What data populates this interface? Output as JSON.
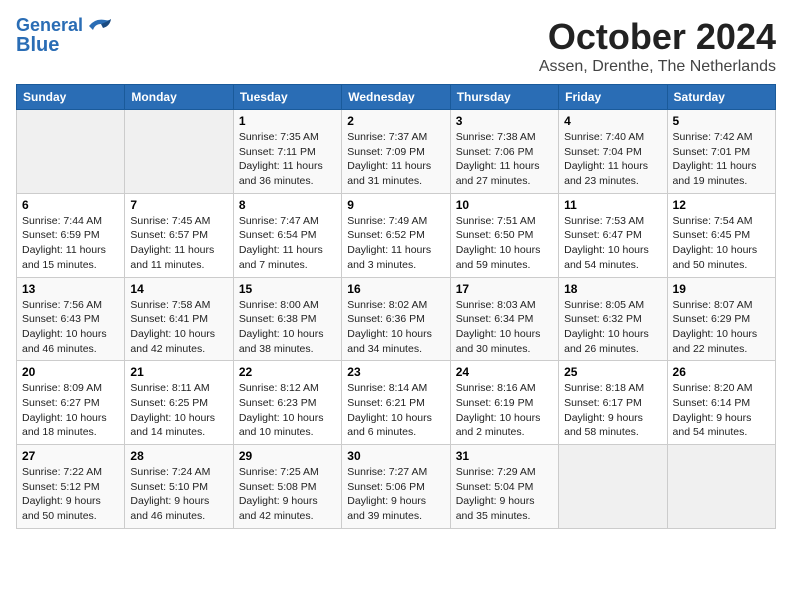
{
  "logo": {
    "line1": "General",
    "line2": "Blue"
  },
  "title": "October 2024",
  "location": "Assen, Drenthe, The Netherlands",
  "days_of_week": [
    "Sunday",
    "Monday",
    "Tuesday",
    "Wednesday",
    "Thursday",
    "Friday",
    "Saturday"
  ],
  "weeks": [
    [
      {
        "day": "",
        "sunrise": "",
        "sunset": "",
        "daylight": ""
      },
      {
        "day": "",
        "sunrise": "",
        "sunset": "",
        "daylight": ""
      },
      {
        "day": "1",
        "sunrise": "Sunrise: 7:35 AM",
        "sunset": "Sunset: 7:11 PM",
        "daylight": "Daylight: 11 hours and 36 minutes."
      },
      {
        "day": "2",
        "sunrise": "Sunrise: 7:37 AM",
        "sunset": "Sunset: 7:09 PM",
        "daylight": "Daylight: 11 hours and 31 minutes."
      },
      {
        "day": "3",
        "sunrise": "Sunrise: 7:38 AM",
        "sunset": "Sunset: 7:06 PM",
        "daylight": "Daylight: 11 hours and 27 minutes."
      },
      {
        "day": "4",
        "sunrise": "Sunrise: 7:40 AM",
        "sunset": "Sunset: 7:04 PM",
        "daylight": "Daylight: 11 hours and 23 minutes."
      },
      {
        "day": "5",
        "sunrise": "Sunrise: 7:42 AM",
        "sunset": "Sunset: 7:01 PM",
        "daylight": "Daylight: 11 hours and 19 minutes."
      }
    ],
    [
      {
        "day": "6",
        "sunrise": "Sunrise: 7:44 AM",
        "sunset": "Sunset: 6:59 PM",
        "daylight": "Daylight: 11 hours and 15 minutes."
      },
      {
        "day": "7",
        "sunrise": "Sunrise: 7:45 AM",
        "sunset": "Sunset: 6:57 PM",
        "daylight": "Daylight: 11 hours and 11 minutes."
      },
      {
        "day": "8",
        "sunrise": "Sunrise: 7:47 AM",
        "sunset": "Sunset: 6:54 PM",
        "daylight": "Daylight: 11 hours and 7 minutes."
      },
      {
        "day": "9",
        "sunrise": "Sunrise: 7:49 AM",
        "sunset": "Sunset: 6:52 PM",
        "daylight": "Daylight: 11 hours and 3 minutes."
      },
      {
        "day": "10",
        "sunrise": "Sunrise: 7:51 AM",
        "sunset": "Sunset: 6:50 PM",
        "daylight": "Daylight: 10 hours and 59 minutes."
      },
      {
        "day": "11",
        "sunrise": "Sunrise: 7:53 AM",
        "sunset": "Sunset: 6:47 PM",
        "daylight": "Daylight: 10 hours and 54 minutes."
      },
      {
        "day": "12",
        "sunrise": "Sunrise: 7:54 AM",
        "sunset": "Sunset: 6:45 PM",
        "daylight": "Daylight: 10 hours and 50 minutes."
      }
    ],
    [
      {
        "day": "13",
        "sunrise": "Sunrise: 7:56 AM",
        "sunset": "Sunset: 6:43 PM",
        "daylight": "Daylight: 10 hours and 46 minutes."
      },
      {
        "day": "14",
        "sunrise": "Sunrise: 7:58 AM",
        "sunset": "Sunset: 6:41 PM",
        "daylight": "Daylight: 10 hours and 42 minutes."
      },
      {
        "day": "15",
        "sunrise": "Sunrise: 8:00 AM",
        "sunset": "Sunset: 6:38 PM",
        "daylight": "Daylight: 10 hours and 38 minutes."
      },
      {
        "day": "16",
        "sunrise": "Sunrise: 8:02 AM",
        "sunset": "Sunset: 6:36 PM",
        "daylight": "Daylight: 10 hours and 34 minutes."
      },
      {
        "day": "17",
        "sunrise": "Sunrise: 8:03 AM",
        "sunset": "Sunset: 6:34 PM",
        "daylight": "Daylight: 10 hours and 30 minutes."
      },
      {
        "day": "18",
        "sunrise": "Sunrise: 8:05 AM",
        "sunset": "Sunset: 6:32 PM",
        "daylight": "Daylight: 10 hours and 26 minutes."
      },
      {
        "day": "19",
        "sunrise": "Sunrise: 8:07 AM",
        "sunset": "Sunset: 6:29 PM",
        "daylight": "Daylight: 10 hours and 22 minutes."
      }
    ],
    [
      {
        "day": "20",
        "sunrise": "Sunrise: 8:09 AM",
        "sunset": "Sunset: 6:27 PM",
        "daylight": "Daylight: 10 hours and 18 minutes."
      },
      {
        "day": "21",
        "sunrise": "Sunrise: 8:11 AM",
        "sunset": "Sunset: 6:25 PM",
        "daylight": "Daylight: 10 hours and 14 minutes."
      },
      {
        "day": "22",
        "sunrise": "Sunrise: 8:12 AM",
        "sunset": "Sunset: 6:23 PM",
        "daylight": "Daylight: 10 hours and 10 minutes."
      },
      {
        "day": "23",
        "sunrise": "Sunrise: 8:14 AM",
        "sunset": "Sunset: 6:21 PM",
        "daylight": "Daylight: 10 hours and 6 minutes."
      },
      {
        "day": "24",
        "sunrise": "Sunrise: 8:16 AM",
        "sunset": "Sunset: 6:19 PM",
        "daylight": "Daylight: 10 hours and 2 minutes."
      },
      {
        "day": "25",
        "sunrise": "Sunrise: 8:18 AM",
        "sunset": "Sunset: 6:17 PM",
        "daylight": "Daylight: 9 hours and 58 minutes."
      },
      {
        "day": "26",
        "sunrise": "Sunrise: 8:20 AM",
        "sunset": "Sunset: 6:14 PM",
        "daylight": "Daylight: 9 hours and 54 minutes."
      }
    ],
    [
      {
        "day": "27",
        "sunrise": "Sunrise: 7:22 AM",
        "sunset": "Sunset: 5:12 PM",
        "daylight": "Daylight: 9 hours and 50 minutes."
      },
      {
        "day": "28",
        "sunrise": "Sunrise: 7:24 AM",
        "sunset": "Sunset: 5:10 PM",
        "daylight": "Daylight: 9 hours and 46 minutes."
      },
      {
        "day": "29",
        "sunrise": "Sunrise: 7:25 AM",
        "sunset": "Sunset: 5:08 PM",
        "daylight": "Daylight: 9 hours and 42 minutes."
      },
      {
        "day": "30",
        "sunrise": "Sunrise: 7:27 AM",
        "sunset": "Sunset: 5:06 PM",
        "daylight": "Daylight: 9 hours and 39 minutes."
      },
      {
        "day": "31",
        "sunrise": "Sunrise: 7:29 AM",
        "sunset": "Sunset: 5:04 PM",
        "daylight": "Daylight: 9 hours and 35 minutes."
      },
      {
        "day": "",
        "sunrise": "",
        "sunset": "",
        "daylight": ""
      },
      {
        "day": "",
        "sunrise": "",
        "sunset": "",
        "daylight": ""
      }
    ]
  ]
}
